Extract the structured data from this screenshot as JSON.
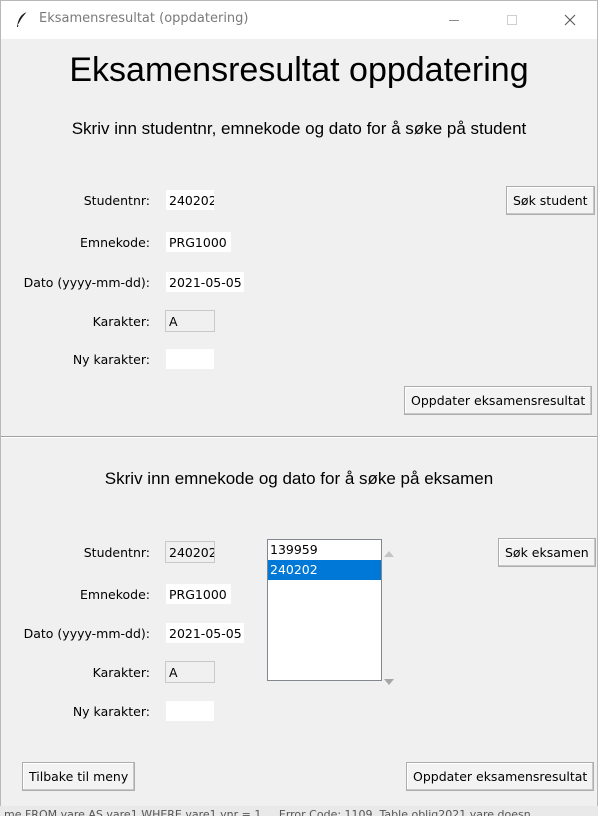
{
  "window": {
    "title": "Eksamensresultat (oppdatering)",
    "icon": "feather-icon"
  },
  "header": {
    "title": "Eksamensresultat oppdatering",
    "subtitle_student": "Skriv inn studentnr, emnekode og dato for å søke på student",
    "subtitle_exam": "Skriv inn emnekode og dato for å søke på eksamen"
  },
  "student_section": {
    "studentnr_label": "Studentnr:",
    "studentnr_value": "240202",
    "emnekode_label": "Emnekode:",
    "emnekode_value": "PRG1000",
    "dato_label": "Dato (yyyy-mm-dd):",
    "dato_value": "2021-05-05",
    "karakter_label": "Karakter:",
    "karakter_value": "A",
    "ny_karakter_label": "Ny karakter:",
    "ny_karakter_value": "",
    "search_button": "Søk student",
    "update_button": "Oppdater eksamensresultat"
  },
  "exam_section": {
    "studentnr_label": "Studentnr:",
    "studentnr_value": "240202",
    "emnekode_label": "Emnekode:",
    "emnekode_value": "PRG1000",
    "dato_label": "Dato (yyyy-mm-dd):",
    "dato_value": "2021-05-05",
    "karakter_label": "Karakter:",
    "karakter_value": "A",
    "ny_karakter_label": "Ny karakter:",
    "ny_karakter_value": "",
    "student_list": [
      "139959",
      "240202"
    ],
    "selected_student": "240202",
    "search_button": "Søk eksamen",
    "update_button": "Oppdater eksamensresultat",
    "back_button": "Tilbake til meny"
  },
  "background_text": "me FROM vare AS vare1 WHERE vare1.vnr = 1 ... Error Code: 1109. Table oblig2021.vare doesn",
  "colors": {
    "window_bg": "#f0f0f0",
    "selection": "#0078d7",
    "titlebar_bg": "#ffffff"
  }
}
